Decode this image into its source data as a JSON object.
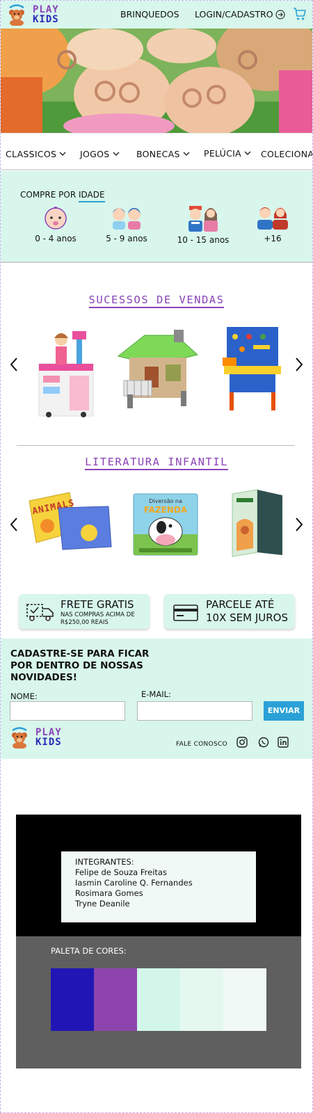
{
  "header": {
    "logo_line1": "PLAY",
    "logo_line2": "KIDS",
    "nav_toys": "BRINQUEDOS",
    "nav_login": "LOGIN/CADASTRO"
  },
  "categories": [
    {
      "label": "CLASSICOS"
    },
    {
      "label": "JOGOS"
    },
    {
      "label": "BONECAS"
    },
    {
      "label": "PELÚCIA"
    },
    {
      "label": "COLECIONAVEIS"
    }
  ],
  "age": {
    "title_prefix": "COMPRE POR ",
    "title_underlined": "IDADE",
    "items": [
      {
        "label": "0 - 4 anos"
      },
      {
        "label": "5 - 9 anos"
      },
      {
        "label": "10 - 15 anos"
      },
      {
        "label": "+16"
      }
    ]
  },
  "sections": {
    "best_sellers": "SUCESSOS DE VENDAS",
    "literature": "LITERATURA INFANTIL"
  },
  "books": {
    "book1_title": "ANIMALS",
    "book2_title_line1": "Diversão na",
    "book2_title_line2": "FAZENDA"
  },
  "promos": {
    "shipping_title": "FRETE GRATIS",
    "shipping_sub_line1": "NAS COMPRAS ACIMA DE",
    "shipping_sub_line2": "R$250,00 REAIS",
    "installments_line1": "PARCELE ATÉ",
    "installments_line2": "10X SEM JUROS"
  },
  "newsletter": {
    "title": "CADASTRE-SE PARA FICAR POR DENTRO DE NOSSAS NOVIDADES!",
    "name_label": "NOME:",
    "email_label": "E-MAIL:",
    "name_value": "",
    "email_value": "",
    "submit": "ENVIAR"
  },
  "footer": {
    "contact": "FALE CONOSCO",
    "logo_line1": "PLAY",
    "logo_line2": "KIDS"
  },
  "presentation": {
    "members_title": "INTEGRANTES:",
    "members": [
      "Felipe de Souza Freitas",
      "Iasmin Caroline Q. Fernandes",
      "Rosimara Gomes",
      "Tryne Deanile"
    ],
    "palette_title": "PALETA DE CORES:",
    "palette": [
      "#2116b5",
      "#8d44ad",
      "#d2f6ea",
      "#e5f8f0",
      "#f1f9f6"
    ]
  },
  "colors": {
    "mint": "#d8f6ec",
    "purple": "#8a44b8",
    "navy": "#2b2ab8",
    "accent_blue": "#2aa1d6"
  }
}
